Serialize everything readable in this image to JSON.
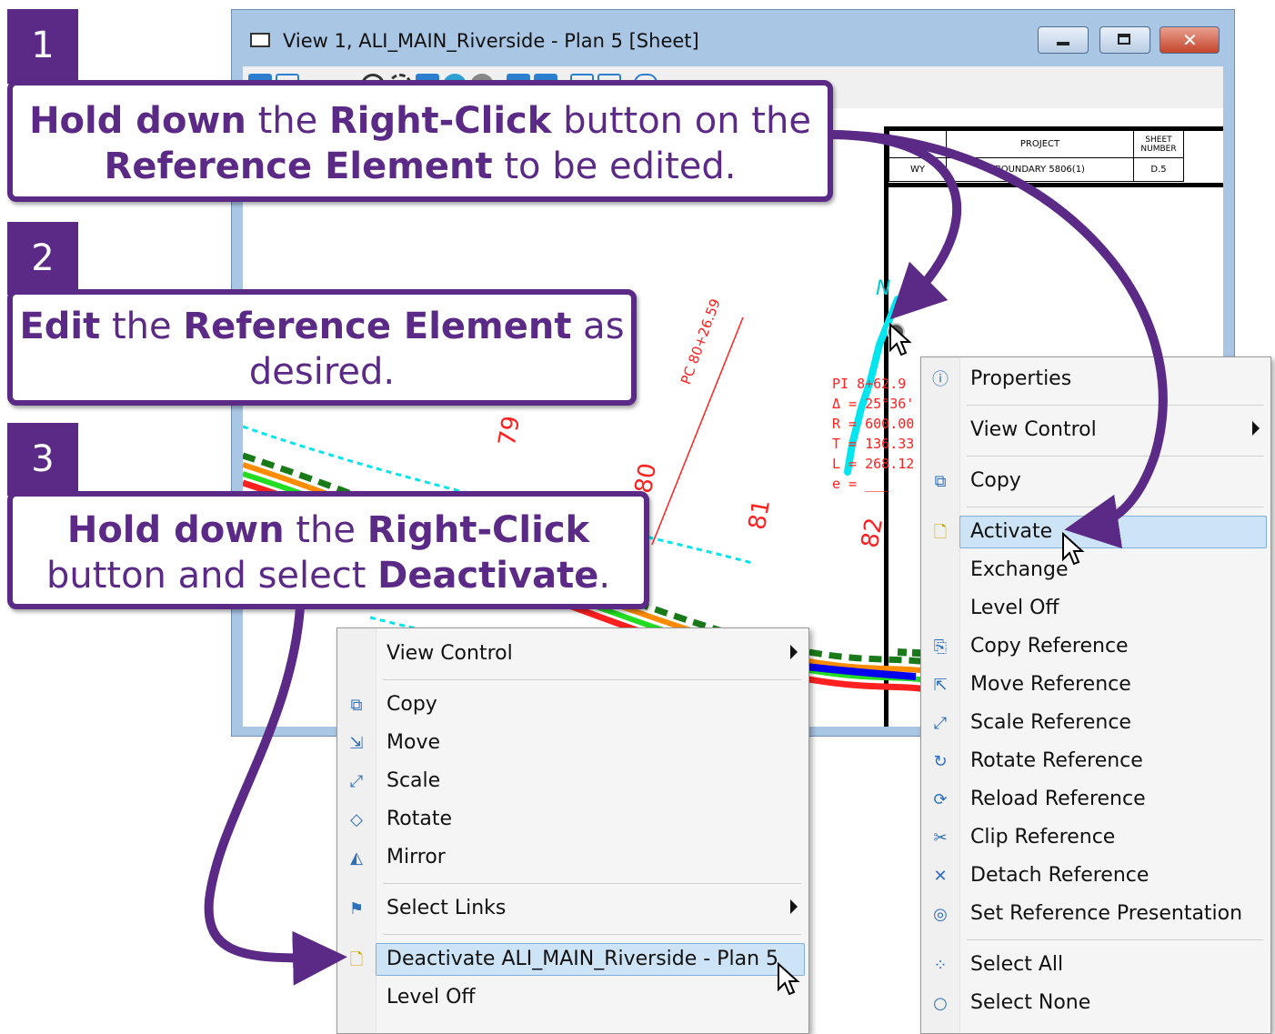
{
  "window": {
    "title": "View 1, ALI_MAIN_Riverside - Plan 5 [Sheet]"
  },
  "title_block": {
    "project_label": "PROJECT",
    "sheet_number_label": "SHEET NUMBER",
    "state": "WY",
    "project": "BOUNDARY 5806(1)",
    "sheet": "D.5"
  },
  "drawing": {
    "station_79": "79",
    "station_80": "80",
    "station_81": "81",
    "station_82": "82",
    "pc_label": "PC 80+26.59",
    "curve_lines": [
      "PI 8+62.9",
      "Δ = 25°36'",
      "R = 600.00",
      "T = 136.33",
      "L = 268.12",
      "e = ___"
    ],
    "north_label": "N"
  },
  "steps": [
    {
      "number": "1",
      "parts": [
        {
          "b": true,
          "t": "Hold down"
        },
        {
          "b": false,
          "t": " the "
        },
        {
          "b": true,
          "t": "Right-Click"
        },
        {
          "b": false,
          "t": " button on the "
        },
        {
          "b": true,
          "t": "Reference Element"
        },
        {
          "b": false,
          "t": " to be edited."
        }
      ]
    },
    {
      "number": "2",
      "parts": [
        {
          "b": true,
          "t": "Edit"
        },
        {
          "b": false,
          "t": " the "
        },
        {
          "b": true,
          "t": "Reference Element"
        },
        {
          "b": false,
          "t": " as desired."
        }
      ]
    },
    {
      "number": "3",
      "parts": [
        {
          "b": true,
          "t": "Hold down"
        },
        {
          "b": false,
          "t": " the "
        },
        {
          "b": true,
          "t": "Right-Click"
        },
        {
          "b": false,
          "t": " button and select "
        },
        {
          "b": true,
          "t": "Deactivate"
        },
        {
          "b": false,
          "t": "."
        }
      ]
    }
  ],
  "menu_right": {
    "items": [
      {
        "label": "Properties",
        "icon": "properties-icon",
        "glyph": "ⓘ"
      },
      {
        "label": "View Control",
        "submenu": true
      },
      {
        "label": "Copy",
        "icon": "copy-icon",
        "glyph": "⧉"
      },
      {
        "label": "Activate",
        "icon": "activate-icon",
        "glyph": "🗋",
        "highlight": true
      },
      {
        "label": "Exchange"
      },
      {
        "label": "Level Off"
      },
      {
        "label": "Copy Reference",
        "icon": "copy-reference-icon",
        "glyph": "⎘"
      },
      {
        "label": "Move Reference",
        "icon": "move-reference-icon",
        "glyph": "⇱"
      },
      {
        "label": "Scale Reference",
        "icon": "scale-reference-icon",
        "glyph": "⤢"
      },
      {
        "label": "Rotate Reference",
        "icon": "rotate-reference-icon",
        "glyph": "↻"
      },
      {
        "label": "Reload Reference",
        "icon": "reload-reference-icon",
        "glyph": "⟳"
      },
      {
        "label": "Clip Reference",
        "icon": "clip-reference-icon",
        "glyph": "✂"
      },
      {
        "label": "Detach Reference",
        "icon": "detach-reference-icon",
        "glyph": "✕"
      },
      {
        "label": "Set Reference Presentation",
        "icon": "set-reference-presentation-icon",
        "glyph": "◎"
      },
      {
        "label": "Select All",
        "icon": "select-all-icon",
        "glyph": "⁘"
      },
      {
        "label": "Select None",
        "icon": "select-none-icon",
        "glyph": "○"
      }
    ]
  },
  "menu_left": {
    "items": [
      {
        "label": "View Control",
        "submenu": true
      },
      {
        "label": "Copy",
        "icon": "copy-icon",
        "glyph": "⧉"
      },
      {
        "label": "Move",
        "icon": "move-icon",
        "glyph": "⇲"
      },
      {
        "label": "Scale",
        "icon": "scale-icon",
        "glyph": "⤢"
      },
      {
        "label": "Rotate",
        "icon": "rotate-icon",
        "glyph": "◇"
      },
      {
        "label": "Mirror",
        "icon": "mirror-icon",
        "glyph": "◭"
      },
      {
        "label": "Select Links",
        "icon": "select-links-icon",
        "glyph": "⚑",
        "submenu": true
      },
      {
        "label": "Deactivate ALI_MAIN_Riverside - Plan 5",
        "icon": "deactivate-icon",
        "glyph": "🗋",
        "highlight": true
      },
      {
        "label": "Level Off"
      }
    ]
  },
  "colors": {
    "callout_purple": "#5b2a86",
    "window_frame": "#a9c6e4",
    "menu_highlight": "#cde4f7",
    "drawing_red": "#ff2020",
    "drawing_cyan": "#00e5ee"
  }
}
